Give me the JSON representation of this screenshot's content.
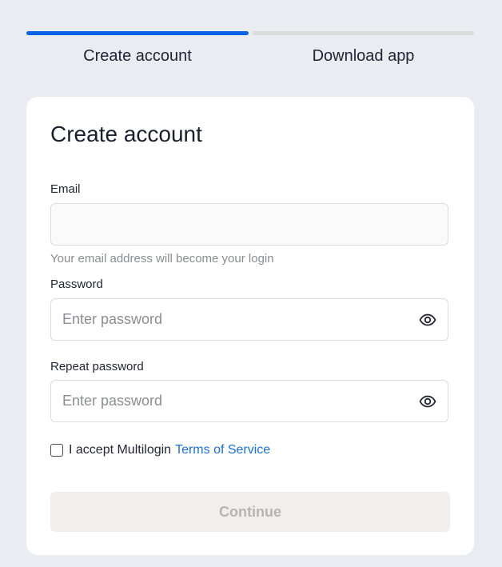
{
  "stepper": {
    "steps": [
      {
        "label": "Create account",
        "active": true
      },
      {
        "label": "Download app",
        "active": false
      }
    ],
    "active_color": "#0a63e6",
    "inactive_color": "#dcdcdc"
  },
  "form": {
    "title": "Create account",
    "email": {
      "label": "Email",
      "value": "",
      "placeholder": "",
      "helper": "Your email address will become your login"
    },
    "password": {
      "label": "Password",
      "value": "",
      "placeholder": "Enter password",
      "toggle_icon": "eye-icon"
    },
    "repeat_password": {
      "label": "Repeat password",
      "value": "",
      "placeholder": "Enter password",
      "toggle_icon": "eye-icon"
    },
    "terms": {
      "checked": false,
      "text": "I accept Multilogin",
      "link_text": "Terms of Service",
      "link_color": "#1d6fcf"
    },
    "continue_label": "Continue",
    "continue_enabled": false
  }
}
